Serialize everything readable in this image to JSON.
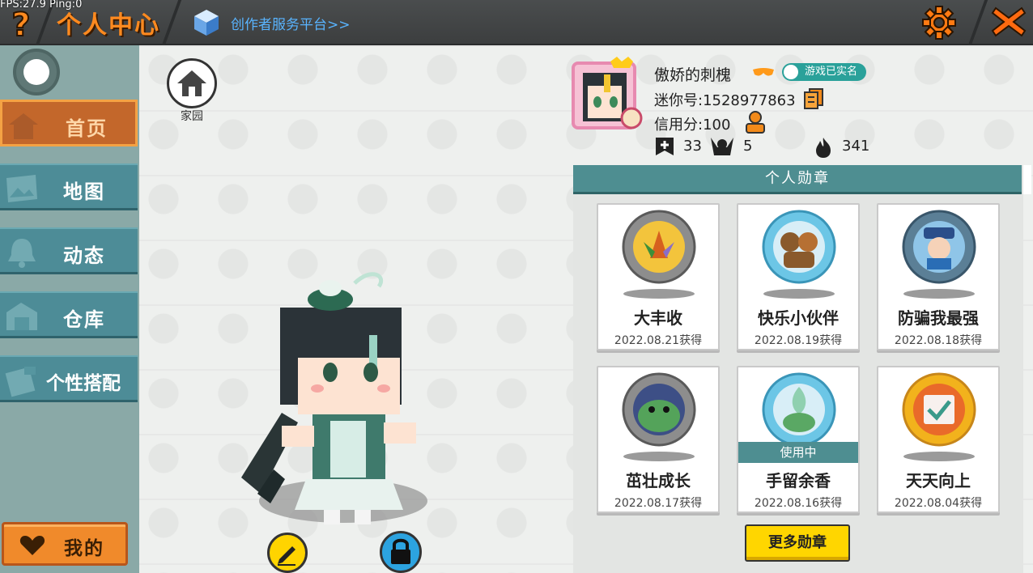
{
  "debug": {
    "fps_text": "FPS:27.9  Ping:0"
  },
  "header": {
    "title": "个人中心",
    "creator_link": "创作者服务平台>>"
  },
  "icons": {
    "help": "help-icon",
    "settings": "gear-icon",
    "close": "close-icon",
    "creator": "cube-icon"
  },
  "sidebar": {
    "items": [
      {
        "label": "首页",
        "icon": "home-icon",
        "active": true
      },
      {
        "label": "地图",
        "icon": "map-icon",
        "active": false
      },
      {
        "label": "动态",
        "icon": "bell-icon",
        "active": false
      },
      {
        "label": "仓库",
        "icon": "warehouse-icon",
        "active": false
      },
      {
        "label": "个性搭配",
        "icon": "outfit-icon",
        "active": false
      }
    ],
    "mine_label": "我的"
  },
  "home": {
    "label": "家园"
  },
  "profile": {
    "nickname": "傲娇的刺槐",
    "verified_label": "游戏已实名",
    "mini_id": "迷你号:1528977863",
    "credit": "信用分:100",
    "stats": {
      "bookmarks": "33",
      "fans": "5",
      "heat": "341"
    }
  },
  "medals": {
    "title": "个人勋章",
    "items": [
      {
        "name": "大丰收",
        "date": "2022.08.21获得",
        "in_use": false
      },
      {
        "name": "快乐小伙伴",
        "date": "2022.08.19获得",
        "in_use": false
      },
      {
        "name": "防骗我最强",
        "date": "2022.08.18获得",
        "in_use": false
      },
      {
        "name": "茁壮成长",
        "date": "2022.08.17获得",
        "in_use": false
      },
      {
        "name": "手留余香",
        "date": "2022.08.16获得",
        "in_use": true,
        "in_use_label": "使用中"
      },
      {
        "name": "天天向上",
        "date": "2022.08.04获得",
        "in_use": false
      }
    ],
    "more_label": "更多勋章"
  },
  "colors": {
    "accent": "#ff8a1f",
    "teal": "#4e8e91",
    "yellow": "#ffd600"
  }
}
